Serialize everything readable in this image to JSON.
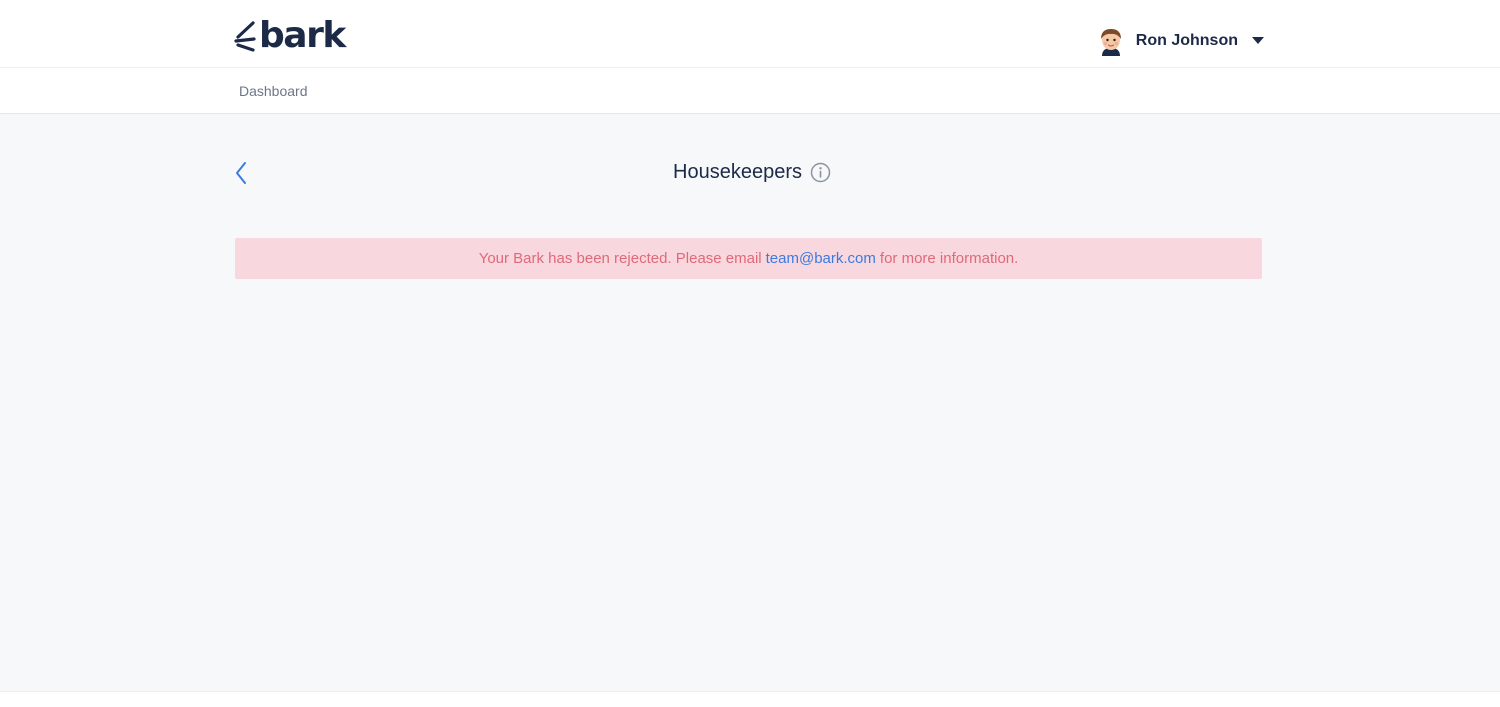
{
  "header": {
    "logo_text": "bark",
    "user": {
      "name": "Ron Johnson"
    }
  },
  "subnav": {
    "dashboard_label": "Dashboard"
  },
  "main": {
    "title": "Housekeepers",
    "alert": {
      "text_before": "Your Bark has been rejected. Please email",
      "email": "team@bark.com",
      "text_after": "for more information."
    }
  },
  "colors": {
    "brand_navy": "#1c2a48",
    "link_blue": "#3b7be0",
    "alert_bg": "#f8d8de",
    "alert_text": "#e0697a",
    "page_bg": "#f7f8fa"
  },
  "icons": {
    "logo": "bark-logo-icon",
    "avatar": "avatar-icon",
    "caret": "caret-down-icon",
    "back": "chevron-left-icon",
    "info": "info-icon"
  }
}
